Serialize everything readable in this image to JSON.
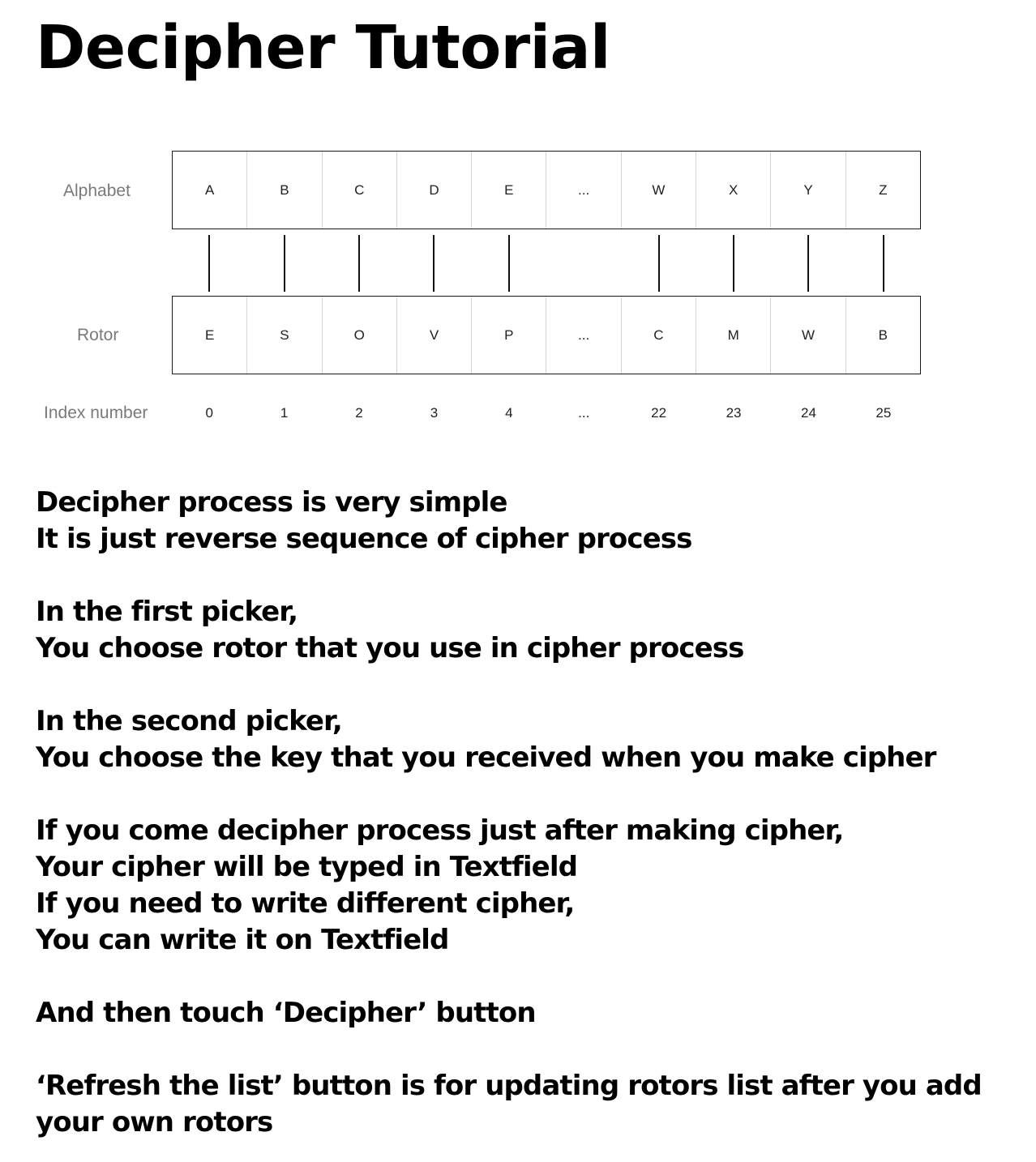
{
  "title": "Decipher Tutorial",
  "diagram": {
    "alphabet_label": "Alphabet",
    "rotor_label": "Rotor",
    "index_label": "Index number",
    "alphabet": [
      "A",
      "B",
      "C",
      "D",
      "E",
      "...",
      "W",
      "X",
      "Y",
      "Z"
    ],
    "rotor": [
      "E",
      "S",
      "O",
      "V",
      "P",
      "...",
      "C",
      "M",
      "W",
      "B"
    ],
    "indices": [
      "0",
      "1",
      "2",
      "3",
      "4",
      "...",
      "22",
      "23",
      "24",
      "25"
    ],
    "connectors": [
      true,
      true,
      true,
      true,
      true,
      false,
      true,
      true,
      true,
      true
    ]
  },
  "paragraphs": [
    [
      "Decipher process is very simple",
      "It is just reverse sequence of cipher process"
    ],
    [
      "In the first picker,",
      "You choose rotor that you use in cipher process"
    ],
    [
      "In the second picker,",
      "You choose the key that you received when you make cipher"
    ],
    [
      "If you come decipher process just after making cipher,",
      "Your cipher will be typed in Textfield",
      "If you need to write different cipher,",
      "You can write it on Textfield"
    ],
    [
      "And then touch ‘Decipher’ button"
    ],
    [
      "‘Refresh the list’ button is for updating rotors list after you add",
      "your own rotors"
    ]
  ]
}
